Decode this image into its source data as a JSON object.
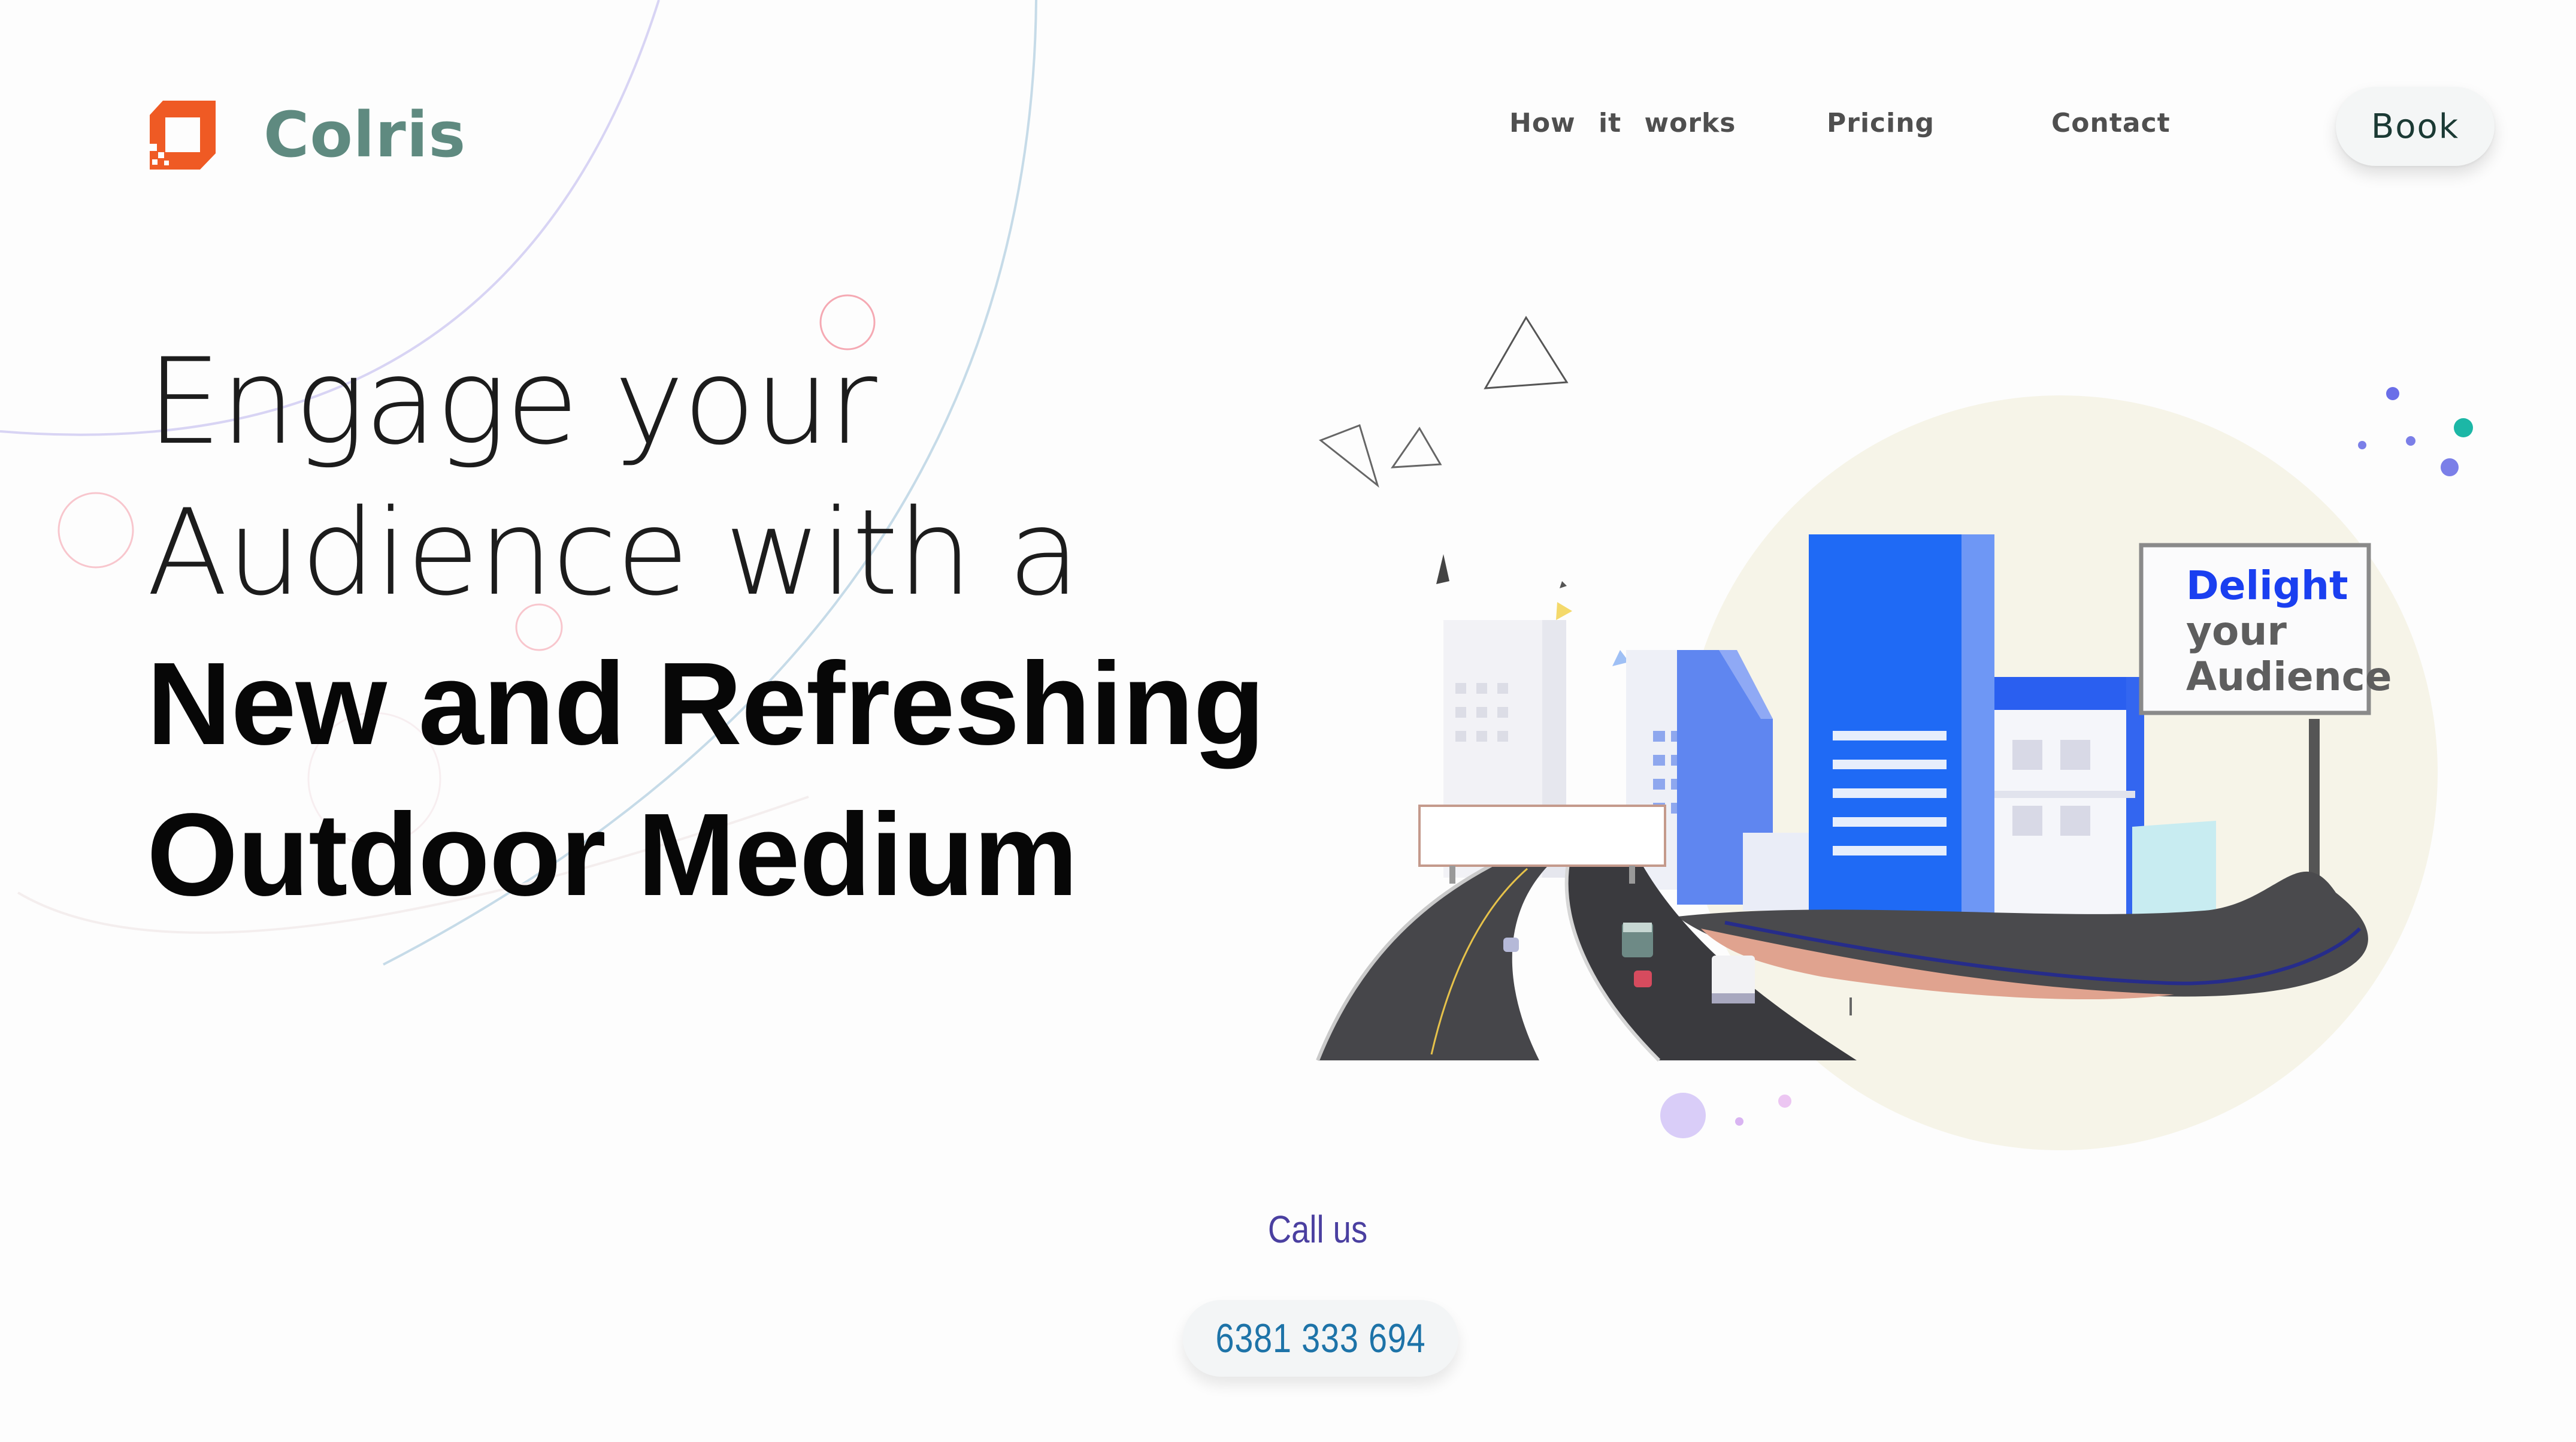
{
  "header": {
    "brand_name": "Colris",
    "nav": {
      "how_it_works": "How it works",
      "pricing": "Pricing",
      "contact": "Contact"
    },
    "book_label": "Book"
  },
  "hero": {
    "line1": "Engage your",
    "line2": "Audience with a",
    "line3": "New and Refreshing",
    "line4": "Outdoor Medium"
  },
  "illustration": {
    "billboard_line1": "Delight",
    "billboard_line2": "your",
    "billboard_line3": "Audience"
  },
  "contact": {
    "call_label": "Call us",
    "phone": "6381 333 694"
  },
  "colors": {
    "brand_mark": "#ef5a24",
    "brand_text": "#5f8a80",
    "call_label": "#4a3fa0",
    "phone": "#1d73a8",
    "billboard_accent": "#1a3ff0"
  },
  "icons": [
    "brand-logo-icon"
  ]
}
